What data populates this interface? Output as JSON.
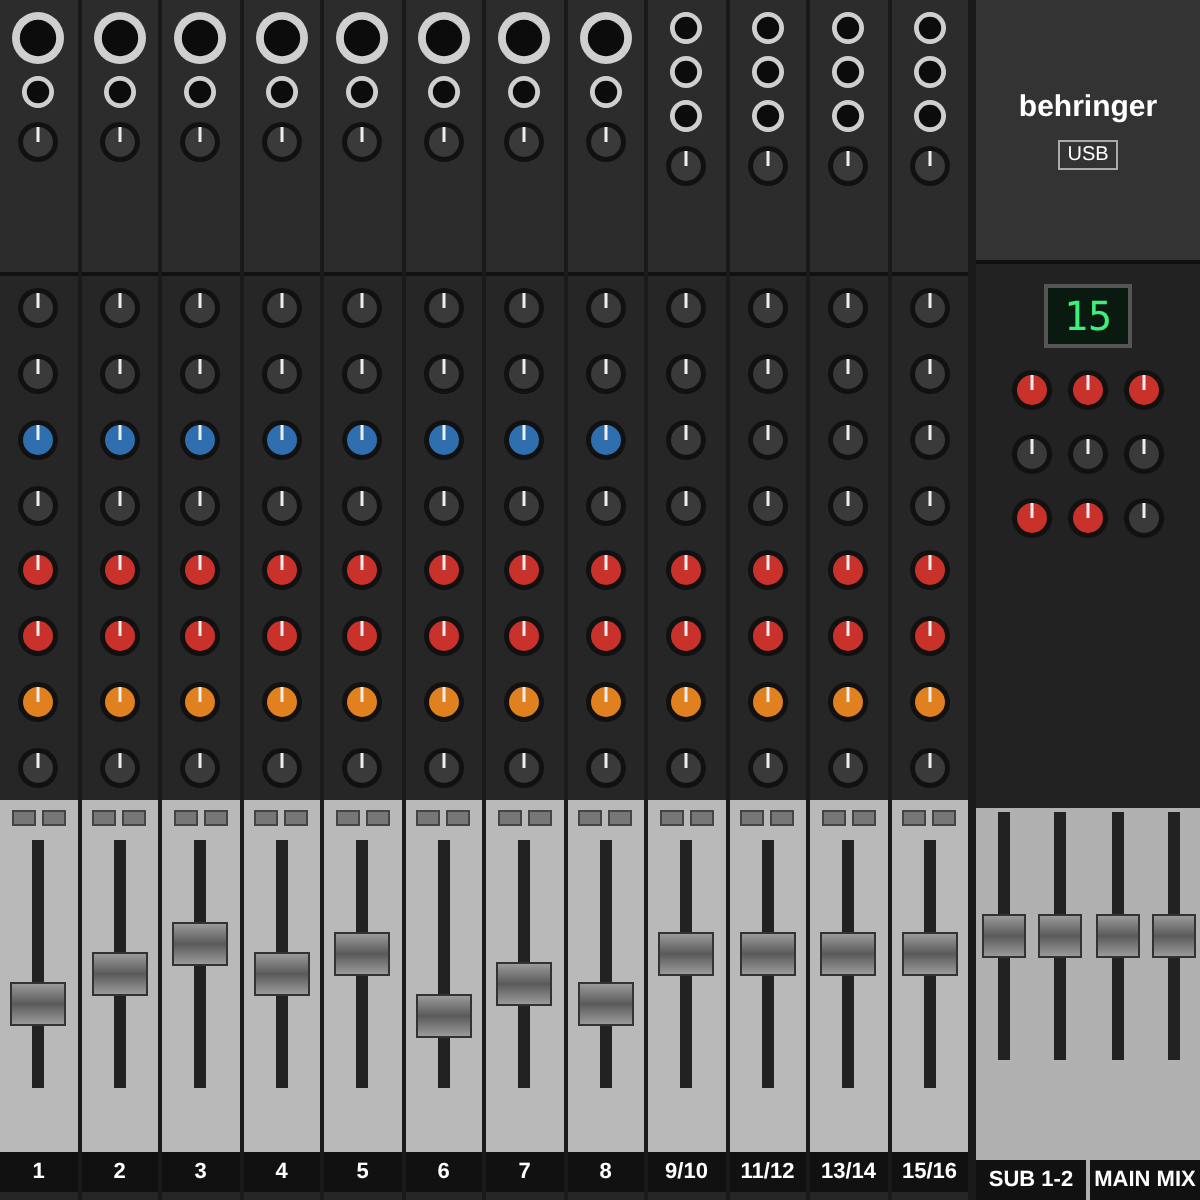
{
  "brand": {
    "name": "behringer",
    "usb": "USB"
  },
  "channels": [
    {
      "label": "1",
      "kind": "mono",
      "level": 0.3
    },
    {
      "label": "2",
      "kind": "mono",
      "level": 0.45
    },
    {
      "label": "3",
      "kind": "mono",
      "level": 0.6
    },
    {
      "label": "4",
      "kind": "mono",
      "level": 0.45
    },
    {
      "label": "5",
      "kind": "mono",
      "level": 0.55
    },
    {
      "label": "6",
      "kind": "mono",
      "level": 0.25
    },
    {
      "label": "7",
      "kind": "mono",
      "level": 0.4
    },
    {
      "label": "8",
      "kind": "mono",
      "level": 0.3
    },
    {
      "label": "9/10",
      "kind": "stereo",
      "level": 0.55
    },
    {
      "label": "11/12",
      "kind": "stereo",
      "level": 0.55
    },
    {
      "label": "13/14",
      "kind": "stereo",
      "level": 0.55
    },
    {
      "label": "15/16",
      "kind": "stereo",
      "level": 0.55
    }
  ],
  "fx_display": "15",
  "master": [
    {
      "label": "SUB 1-2",
      "faders": [
        {
          "level": 0.5
        },
        {
          "level": 0.5
        }
      ]
    },
    {
      "label": "MAIN MIX",
      "faders": [
        {
          "level": 0.5
        },
        {
          "level": 0.5
        }
      ]
    }
  ]
}
